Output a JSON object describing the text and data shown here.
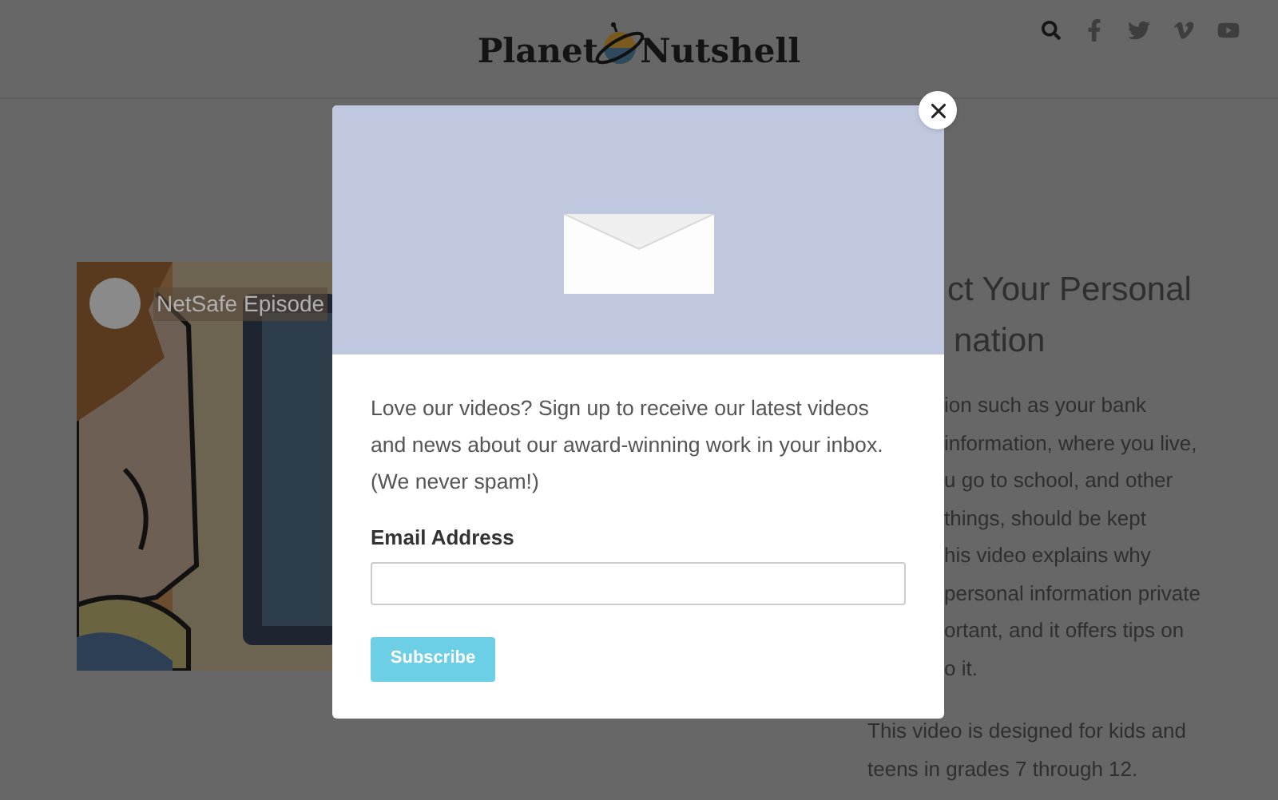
{
  "header": {
    "logo": [
      "Planet",
      "Nutshell"
    ],
    "icons": [
      {
        "kind": "search"
      },
      {
        "kind": "facebook"
      },
      {
        "kind": "twitter"
      },
      {
        "kind": "vimeo"
      },
      {
        "kind": "youtube"
      }
    ]
  },
  "video": {
    "kind": "picture",
    "title": "NetSafe Episode"
  },
  "article": {
    "title_lines": [
      "ct Your Personal",
      "nation"
    ],
    "body_lines": [
      "ion such as your bank",
      "information, where you live,",
      "u go to school, and other",
      "things, should be kept",
      "his video explains why",
      "personal information private",
      "ortant, and it offers tips on",
      "o it."
    ],
    "paragraph": "This video is designed for kids and teens in grades 7 through 12."
  },
  "modal": {
    "message": "Love our videos? Sign up to receive our latest videos and news about our award-winning work in your inbox. (We never spam!)",
    "email_label": "Email Address",
    "button": "Subscribe"
  }
}
